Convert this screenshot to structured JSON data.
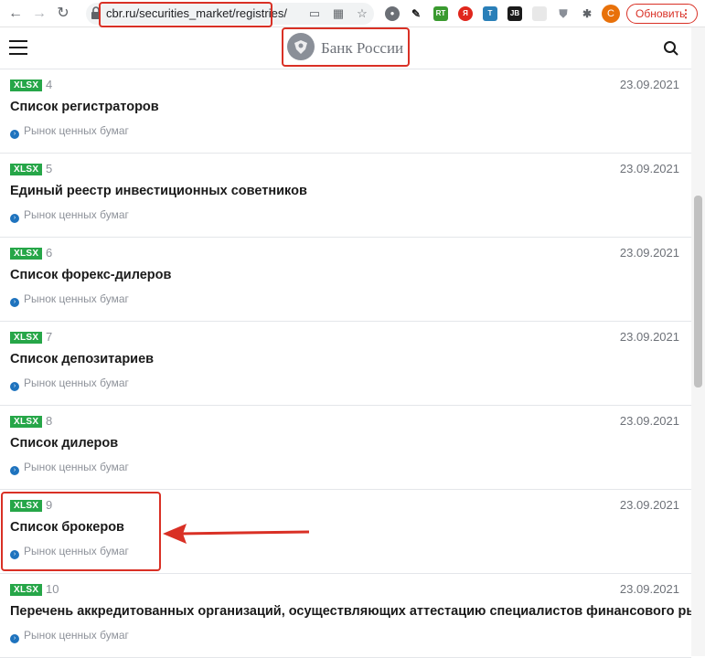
{
  "browser": {
    "url": "cbr.ru/securities_market/registries/",
    "update_label": "Обновить",
    "avatar_letter": "С",
    "extensions": [
      "ext-circle-icon",
      "eyedropper-icon",
      "rt-icon",
      "yandex-icon",
      "telegram-icon",
      "jb-icon",
      "gray-box-icon",
      "shield-v-icon",
      "puzzle-icon"
    ]
  },
  "header": {
    "logo_text": "Банк России"
  },
  "documents": [
    {
      "badge": "XLSX",
      "num": "4",
      "date": "23.09.2021",
      "title": "Список регистраторов",
      "tag": "Рынок ценных бумаг"
    },
    {
      "badge": "XLSX",
      "num": "5",
      "date": "23.09.2021",
      "title": "Единый реестр инвестиционных советников",
      "tag": "Рынок ценных бумаг"
    },
    {
      "badge": "XLSX",
      "num": "6",
      "date": "23.09.2021",
      "title": "Список форекс-дилеров",
      "tag": "Рынок ценных бумаг"
    },
    {
      "badge": "XLSX",
      "num": "7",
      "date": "23.09.2021",
      "title": "Список депозитариев",
      "tag": "Рынок ценных бумаг"
    },
    {
      "badge": "XLSX",
      "num": "8",
      "date": "23.09.2021",
      "title": "Список дилеров",
      "tag": "Рынок ценных бумаг"
    },
    {
      "badge": "XLSX",
      "num": "9",
      "date": "23.09.2021",
      "title": "Список брокеров",
      "tag": "Рынок ценных бумаг"
    },
    {
      "badge": "XLSX",
      "num": "10",
      "date": "23.09.2021",
      "title": "Перечень аккредитованных организаций, осуществляющих аттестацию специалистов финансового рынка",
      "tag": "Рынок ценных бумаг"
    }
  ],
  "colors": {
    "badge_green": "#26a648",
    "annotation_red": "#d93025",
    "tag_blue": "#1e73be"
  }
}
